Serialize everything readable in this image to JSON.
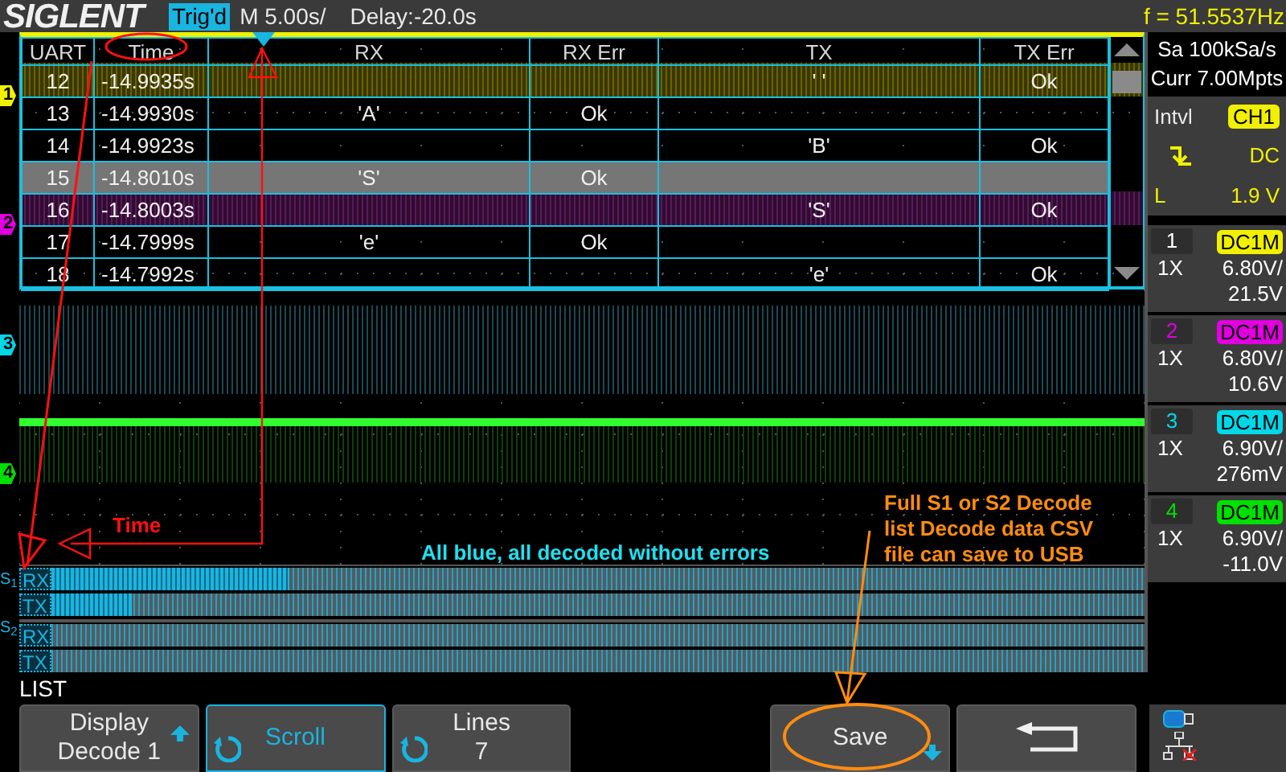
{
  "header": {
    "brand": "SIGLENT",
    "trigger_status": "Trig'd",
    "timebase": "M 5.00s/",
    "delay": "Delay:-20.0s",
    "frequency": "f = 51.5537Hz"
  },
  "decode_table": {
    "columns": [
      "UART",
      "Time",
      "RX",
      "RX Err",
      "TX",
      "TX Err"
    ],
    "rows": [
      {
        "uart": "12",
        "time": "-14.9935s",
        "tx": "' '",
        "tx_err": "Ok",
        "selected": false
      },
      {
        "uart": "13",
        "time": "-14.9930s",
        "rx": "'A'",
        "rx_err": "Ok",
        "selected": false
      },
      {
        "uart": "14",
        "time": "-14.9923s",
        "tx": "'B'",
        "tx_err": "Ok",
        "selected": false
      },
      {
        "uart": "15",
        "time": "-14.8010s",
        "rx": "'S'",
        "rx_err": "Ok",
        "selected": true
      },
      {
        "uart": "16",
        "time": "-14.8003s",
        "tx": "'S'",
        "tx_err": "Ok",
        "selected": false
      },
      {
        "uart": "17",
        "time": "-14.7999s",
        "rx": "'e'",
        "rx_err": "Ok",
        "selected": false
      },
      {
        "uart": "18",
        "time": "-14.7992s",
        "tx": "'e'",
        "tx_err": "Ok",
        "selected": false
      }
    ]
  },
  "channel_markers": [
    {
      "label": "1",
      "color": "#f0f000"
    },
    {
      "label": "2",
      "color": "#e000e0"
    },
    {
      "label": "3",
      "color": "#00d8e8"
    },
    {
      "label": "4",
      "color": "#00e000"
    }
  ],
  "annotations": [
    {
      "text": "Time",
      "color": "#ff1010"
    },
    {
      "text": "All blue, all decoded without errors",
      "color": "#20e0f0"
    },
    {
      "lines": [
        "Full S1 or S2 Decode",
        "list Decode data CSV",
        "file can save to USB"
      ],
      "color": "#ff8c10"
    }
  ],
  "bus": [
    {
      "label": "S$_{1}$",
      "lanes": [
        "RX",
        "TX"
      ]
    },
    {
      "label": "S$_{2}$",
      "lanes": [
        "RX",
        "TX"
      ]
    }
  ],
  "acquisition": {
    "sample_rate": "Sa 100kSa/s",
    "memory": "Curr 7.00Mpts"
  },
  "trigger": {
    "type": "Intvl",
    "source": "CH1",
    "coupling": "DC",
    "level_label": "L",
    "level_value": "1.9 V"
  },
  "channels": [
    {
      "number": "1",
      "coupling": "DC1M",
      "probe": "1X",
      "scale": "6.80V/",
      "offset": "21.5V",
      "color": "#f0f000",
      "selected": true
    },
    {
      "number": "2",
      "coupling": "DC1M",
      "probe": "1X",
      "scale": "6.80V/",
      "offset": "10.6V",
      "color": "#e000e0",
      "selected": false
    },
    {
      "number": "3",
      "coupling": "DC1M",
      "probe": "1X",
      "scale": "6.90V/",
      "offset": "276mV",
      "color": "#00d8e8",
      "selected": false
    },
    {
      "number": "4",
      "coupling": "DC1M",
      "probe": "1X",
      "scale": "6.90V/",
      "offset": "-11.0V",
      "color": "#00e000",
      "selected": false
    }
  ],
  "menu": {
    "title": "LIST",
    "buttons": [
      {
        "kind": "arrow",
        "label": "Display",
        "value": "Decode 1",
        "selected": false
      },
      {
        "kind": "knob",
        "label": "Scroll",
        "selected": true
      },
      {
        "kind": "knob",
        "label": "Lines",
        "value": "7",
        "selected": false
      },
      {
        "kind": "menu",
        "label": "Save",
        "selected": false
      },
      {
        "kind": "back",
        "selected": false
      }
    ]
  }
}
